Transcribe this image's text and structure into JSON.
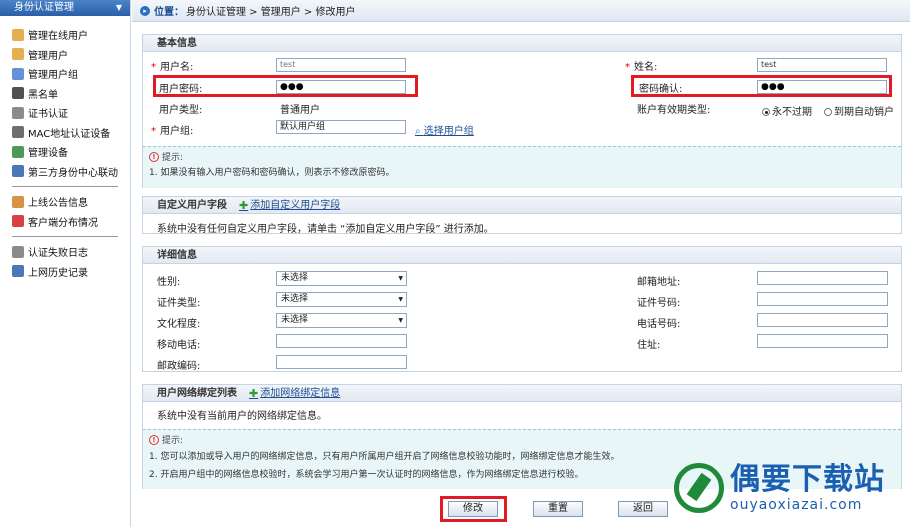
{
  "sidebar": {
    "title": "身份认证管理",
    "items": [
      {
        "label": "管理在线用户",
        "icon": "users-online-icon",
        "color": "#e0a030"
      },
      {
        "label": "管理用户",
        "icon": "user-icon",
        "color": "#e0a030"
      },
      {
        "label": "管理用户组",
        "icon": "user-group-icon",
        "color": "#4a7fd0"
      },
      {
        "label": "黑名单",
        "icon": "blacklist-icon",
        "color": "#333"
      },
      {
        "label": "证书认证",
        "icon": "certificate-icon",
        "color": "#777"
      },
      {
        "label": "MAC地址认证设备",
        "icon": "mac-device-icon",
        "color": "#555"
      },
      {
        "label": "管理设备",
        "icon": "device-icon",
        "color": "#2a8a3a"
      },
      {
        "label": "第三方身份中心联动",
        "icon": "third-party-icon",
        "color": "#2a5fa8"
      }
    ],
    "items2": [
      {
        "label": "上线公告信息",
        "icon": "announcement-icon",
        "color": "#d08020"
      },
      {
        "label": "客户端分布情况",
        "icon": "client-distribution-icon",
        "color": "#d02020"
      }
    ],
    "items3": [
      {
        "label": "认证失败日志",
        "icon": "fail-log-icon",
        "color": "#777"
      },
      {
        "label": "上网历史记录",
        "icon": "history-icon",
        "color": "#2a5fa8"
      }
    ]
  },
  "breadcrumb": {
    "prefix": "位置：",
    "path": "身份认证管理 > 管理用户 > 修改用户"
  },
  "basic": {
    "title": "基本信息",
    "username_label": "用户名:",
    "username_value": "test",
    "realname_label": "姓名:",
    "realname_value": "test",
    "password_label": "用户密码:",
    "password_value": "●●●",
    "confirm_label": "密码确认:",
    "confirm_value": "●●●",
    "usertype_label": "用户类型:",
    "usertype_value": "普通用户",
    "validity_label": "账户有效期类型:",
    "validity_never": "永不过期",
    "validity_expire": "到期自动销户",
    "group_label": "用户组:",
    "group_value": "默认用户组",
    "group_select": "选择用户组",
    "tip_title": "提示:",
    "tip_text": "1. 如果没有输入用户密码和密码确认，则表示不修改原密码。"
  },
  "custom": {
    "title": "自定义用户字段",
    "add": "添加自定义用户字段",
    "text": "系统中没有任何自定义用户字段，请单击 “添加自定义用户字段” 进行添加。"
  },
  "detail": {
    "title": "详细信息",
    "gender_label": "性别:",
    "gender_value": "未选择",
    "idtype_label": "证件类型:",
    "idtype_value": "未选择",
    "edu_label": "文化程度:",
    "edu_value": "未选择",
    "mobile_label": "移动电话:",
    "zip_label": "邮政编码:",
    "email_label": "邮箱地址:",
    "idno_label": "证件号码:",
    "phone_label": "电话号码:",
    "addr_label": "住址:"
  },
  "network": {
    "title": "用户网络绑定列表",
    "add": "添加网络绑定信息",
    "text": "系统中没有当前用户的网络绑定信息。",
    "tip_title": "提示:",
    "tip1": "1. 您可以添加或导入用户的网络绑定信息，只有用户所属用户组开启了网络信息校验功能时，网络绑定信息才能生效。",
    "tip2": "2. 开启用户组中的网络信息校验时，系统会学习用户第一次认证时的网络信息，作为网络绑定信息进行校验。"
  },
  "buttons": {
    "modify": "修改",
    "reset": "重置",
    "back": "返回"
  },
  "watermark": {
    "cn": "偶要下载站",
    "url": "ouyaoxiazai.com"
  }
}
